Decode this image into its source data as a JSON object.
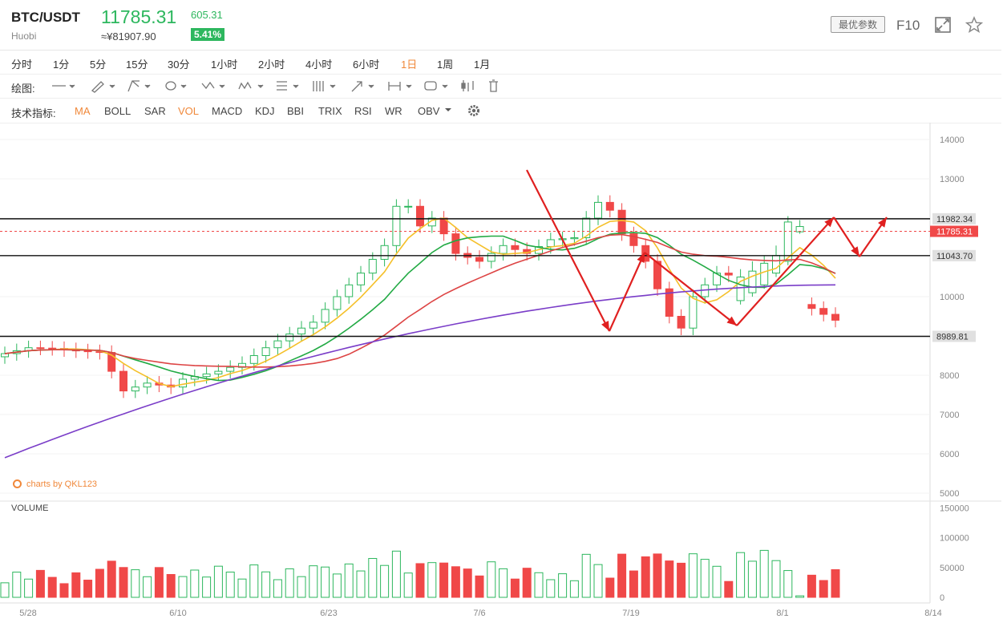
{
  "header": {
    "pair": "BTC/USDT",
    "exchange": "Huobi",
    "price": "11785.31",
    "cny_price": "≈¥81907.90",
    "change_abs": "605.31",
    "change_pct": "5.41%",
    "params_button": "最优参数",
    "f10": "F10",
    "icons": [
      "expand-icon",
      "star-icon"
    ]
  },
  "timeframes": {
    "items": [
      "分时",
      "1分",
      "5分",
      "15分",
      "30分",
      "1小时",
      "2小时",
      "4小时",
      "6小时",
      "1日",
      "1周",
      "1月"
    ],
    "active": "1日"
  },
  "drawing": {
    "label": "绘图:",
    "tools": [
      "line-tool-icon",
      "pen-tool-icon",
      "fork-tool-icon",
      "ellipse-tool-icon",
      "zigzag-tool-icon",
      "pattern-tool-icon",
      "fib-tool-icon",
      "channel-tool-icon",
      "arrow-tool-icon",
      "measure-tool-icon",
      "text-tool-icon",
      "candle-tool-icon",
      "trash-icon"
    ]
  },
  "indicators": {
    "label": "技术指标:",
    "items": [
      "MA",
      "BOLL",
      "SAR",
      "VOL",
      "MACD",
      "KDJ",
      "BBI",
      "TRIX",
      "RSI",
      "WR",
      "OBV"
    ],
    "active": [
      "MA",
      "VOL"
    ],
    "settings_icon": "gear-icon"
  },
  "watermark": "charts by QKL123",
  "volume_label": "VOLUME",
  "chart_data": {
    "type": "candlestick",
    "x_ticks": [
      "5/28",
      "6/10",
      "6/23",
      "7/6",
      "7/19",
      "8/1",
      "8/14"
    ],
    "y_ticks": [
      "14000",
      "13000",
      "12000",
      "11000",
      "10000",
      "9000",
      "8000",
      "7000",
      "6000",
      "5000"
    ],
    "volume_ticks": [
      "150000",
      "100000",
      "50000",
      "0"
    ],
    "horizontal_lines": [
      {
        "label": "11982.34",
        "value": 11982.34
      },
      {
        "label": "11043.70",
        "value": 11043.7
      },
      {
        "label": "8989.81",
        "value": 8989.81
      }
    ],
    "last_price_label": "11785.31",
    "colors": {
      "up": "#2db75e",
      "down": "#f04848",
      "ma_fast": "#f5c02a",
      "ma_mid": "#22aa44",
      "ma_slow": "#dd4444",
      "ma_long": "#7a3dc8",
      "annotation": "#e02020"
    }
  }
}
